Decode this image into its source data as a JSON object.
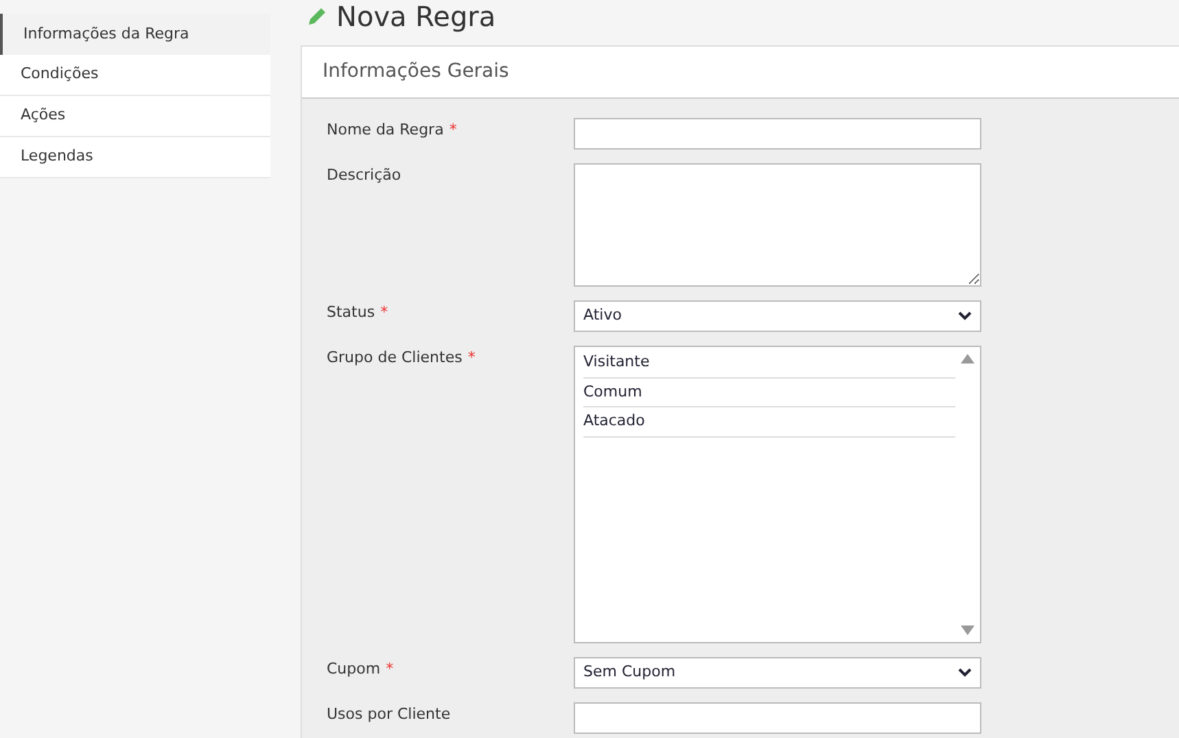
{
  "sidebar": {
    "items": [
      {
        "label": "Informações da Regra",
        "selected": true
      },
      {
        "label": "Condições",
        "selected": false
      },
      {
        "label": "Ações",
        "selected": false
      },
      {
        "label": "Legendas",
        "selected": false
      }
    ]
  },
  "page_title": "Nova Regra",
  "panel": {
    "title": "Informações Gerais",
    "fields": [
      {
        "kind": "text",
        "label": "Nome da Regra",
        "required_mark": "*"
      },
      {
        "kind": "textarea",
        "label": "Descrição"
      },
      {
        "kind": "select",
        "label": "Status",
        "required_mark": "*",
        "value": "Ativo"
      },
      {
        "kind": "multiselect",
        "label": "Grupo de Clientes",
        "required_mark": "*",
        "options": [
          "Visitante",
          "Comum",
          "Atacado"
        ]
      },
      {
        "kind": "select",
        "label": "Cupom",
        "required_mark": "*",
        "value": "Sem Cupom"
      },
      {
        "kind": "text",
        "label": "Usos por Cliente"
      }
    ]
  }
}
